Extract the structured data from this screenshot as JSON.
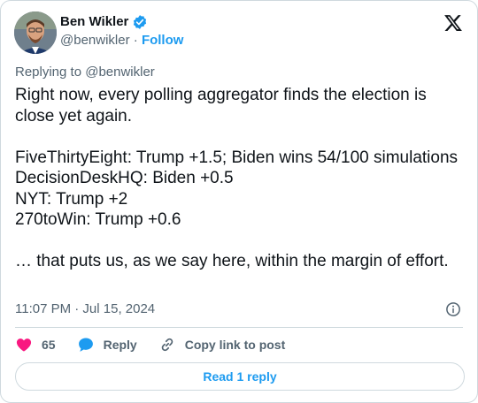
{
  "author": {
    "name": "Ben Wikler",
    "handle": "@benwikler",
    "separator": "·",
    "follow_label": "Follow"
  },
  "replying_to": "Replying to @benwikler",
  "tweet": {
    "lines": [
      "Right now, every polling aggregator finds the election is close yet again.",
      "",
      "FiveThirtyEight: Trump +1.5; Biden wins 54/100 simulations",
      "DecisionDeskHQ: Biden +0.5",
      "NYT: Trump +2",
      "270toWin: Trump +0.6",
      "",
      "… that puts us, as we say here, within the margin of effort."
    ]
  },
  "timestamp": "11:07 PM · Jul 15, 2024",
  "actions": {
    "like_count": "65",
    "reply_label": "Reply",
    "copy_label": "Copy link to post"
  },
  "read_replies_label": "Read 1 reply",
  "icons": {
    "verified": "verified-badge-icon",
    "x_logo": "x-logo-icon",
    "info": "info-icon",
    "heart": "heart-icon",
    "reply": "speech-bubble-icon",
    "link": "link-icon"
  },
  "colors": {
    "accent": "#1d9bf0",
    "like": "#f91880",
    "muted": "#536471",
    "text": "#0f1419",
    "border": "#cfd9de"
  }
}
